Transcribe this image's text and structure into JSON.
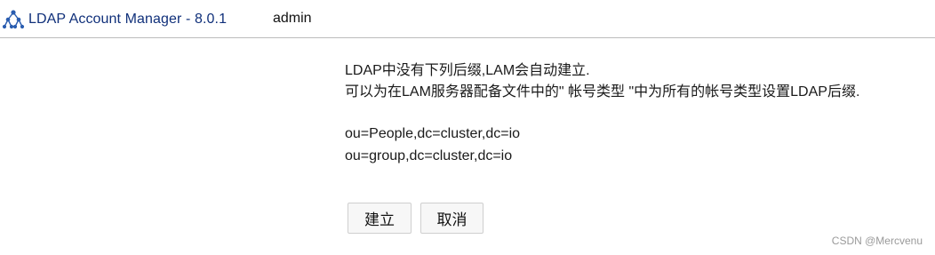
{
  "header": {
    "app_title": "LDAP Account Manager - 8.0.1",
    "username": "admin",
    "logo_icon": "lam-network-logo-icon"
  },
  "message": {
    "line1": "LDAP中没有下列后缀,LAM会自动建立.",
    "line2": "可以为在LAM服务器配备文件中的\" 帐号类型 \"中为所有的帐号类型设置LDAP后缀."
  },
  "suffixes": [
    "ou=People,dc=cluster,dc=io",
    "ou=group,dc=cluster,dc=io"
  ],
  "buttons": {
    "create": "建立",
    "cancel": "取消"
  },
  "watermark": "CSDN @Mercvenu",
  "colors": {
    "title": "#10307a",
    "logo": "#2a5db0",
    "header_border": "#bcbcbc",
    "button_bg": "#f7f7f7"
  }
}
